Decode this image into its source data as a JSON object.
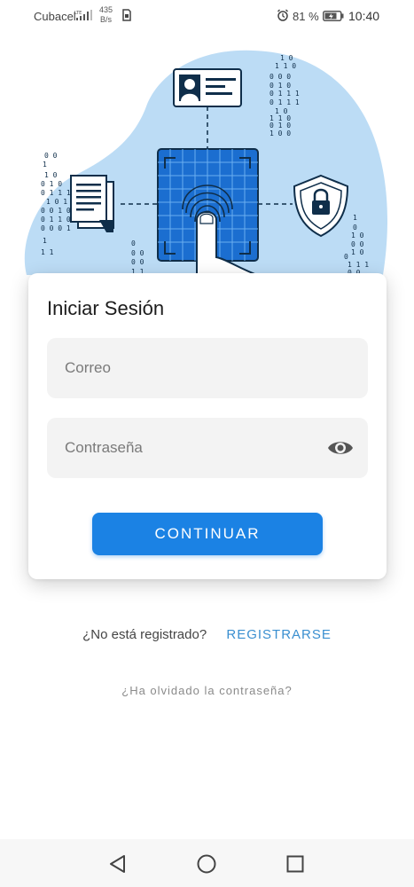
{
  "status_bar": {
    "carrier": "Cubacel",
    "network_type": "LTE",
    "speed_value": "435",
    "speed_unit": "B/s",
    "battery_percent": "81 %",
    "time": "10:40"
  },
  "login_card": {
    "title": "Iniciar Sesión",
    "email_placeholder": "Correo",
    "password_placeholder": "Contraseña",
    "continue_label": "CONTINUAR"
  },
  "register": {
    "question": "¿No está registrado?",
    "link_label": "REGISTRARSE"
  },
  "forgot_password": "¿Ha olvidado la contraseña?",
  "icons": {
    "alarm": "alarm-icon",
    "battery": "battery-icon",
    "password_toggle": "eye-icon",
    "nav_back": "back-triangle-icon",
    "nav_home": "home-circle-icon",
    "nav_recent": "recent-square-icon"
  },
  "colors": {
    "primary": "#1b82e4",
    "link": "#3a8fd0",
    "illustration_blob": "#bcdcf5",
    "field_bg": "#f3f3f3"
  }
}
